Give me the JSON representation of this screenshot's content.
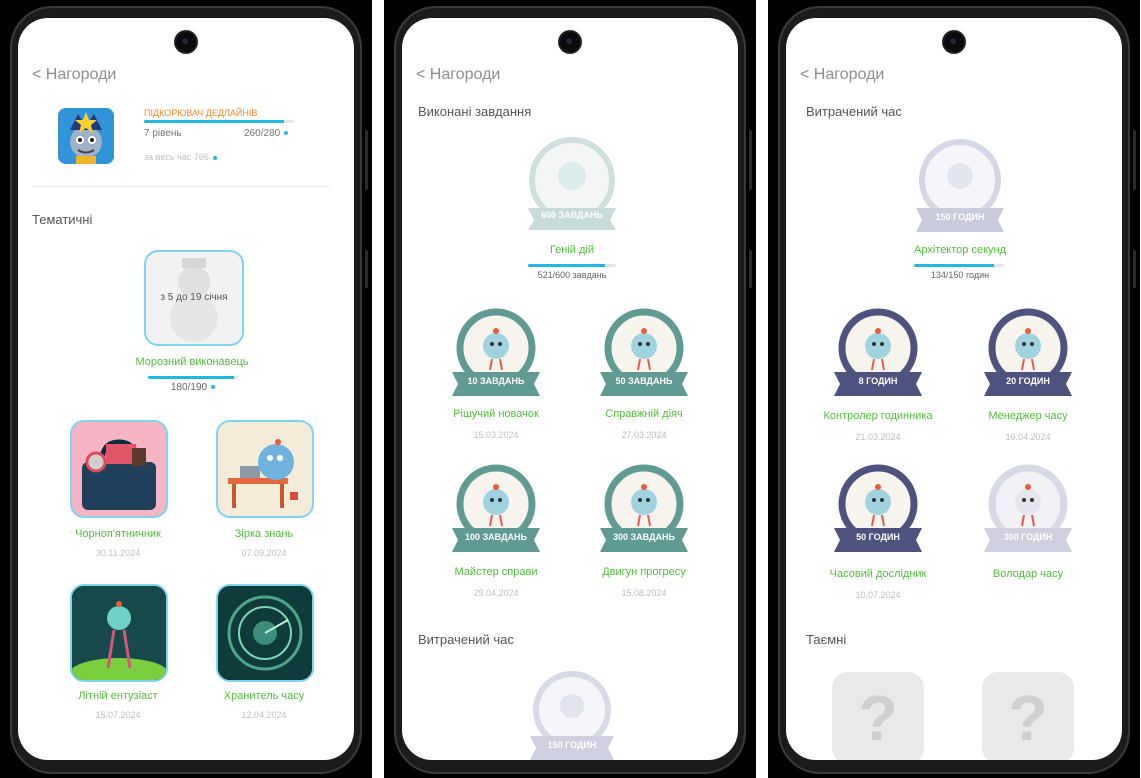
{
  "screen1": {
    "back_label": "Нагороди",
    "profile": {
      "rank_title": "ПІДКОРЮВАЧ ДЕДЛАЙНІВ",
      "level": "7 рівень",
      "progress": "260/280",
      "progress_fraction": 0.93,
      "total": "за весь час 766"
    },
    "section_thematic": "Тематичні",
    "seasonal": {
      "overlay": "з 5 до 19 січня",
      "name": "Морозний виконавець",
      "progress": "180/190",
      "progress_fraction": 0.95
    },
    "badges": [
      {
        "name": "Чорноп'ятничник",
        "date": "30.11.2024"
      },
      {
        "name": "Зірка знань",
        "date": "07.09.2024"
      },
      {
        "name": "Літній ентузіаст",
        "date": "15.07.2024"
      },
      {
        "name": "Хранитель часу",
        "date": "12.04.2024"
      }
    ]
  },
  "screen2": {
    "back_label": "Нагороди",
    "section_done": "Виконані завдання",
    "featured": {
      "ribbon": "600 ЗАВДАНЬ",
      "name": "Геній дій",
      "progress": "521/600 завдань",
      "progress_fraction": 0.87
    },
    "medals": [
      {
        "ribbon": "10 ЗАВДАНЬ",
        "name": "Рішучий новачок",
        "date": "15.03.2024"
      },
      {
        "ribbon": "50 ЗАВДАНЬ",
        "name": "Справжній діяч",
        "date": "27.03.2024"
      },
      {
        "ribbon": "100 ЗАВДАНЬ",
        "name": "Майстер справи",
        "date": "29.04.2024"
      },
      {
        "ribbon": "300 ЗАВДАНЬ",
        "name": "Двигун прогресу",
        "date": "15.08.2024"
      }
    ],
    "section_time": "Витрачений час",
    "peek_ribbon": "150 ГОДИН"
  },
  "screen3": {
    "back_label": "Нагороди",
    "section_time": "Витрачений час",
    "featured": {
      "ribbon": "150 ГОДИН",
      "name": "Архітектор секунд",
      "progress": "134/150 годин",
      "progress_fraction": 0.89
    },
    "medals": [
      {
        "ribbon": "8 ГОДИН",
        "name": "Контролер годинника",
        "date": "21.03.2024"
      },
      {
        "ribbon": "20 ГОДИН",
        "name": "Менеджер часу",
        "date": "16.04.2024"
      },
      {
        "ribbon": "50 ГОДИН",
        "name": "Часовий дослідник",
        "date": "10.07.2024"
      },
      {
        "ribbon": "300 ГОДИН",
        "name": "Володар часу",
        "date": ""
      }
    ],
    "section_secret": "Таємні",
    "mystery_symbol": "?"
  },
  "colors": {
    "accent_green": "#4fbf3a",
    "progress_blue": "#22b8e6",
    "task_medal": "#5f9a93",
    "time_medal": "#4e527f",
    "locked": "#c9c9d8"
  }
}
